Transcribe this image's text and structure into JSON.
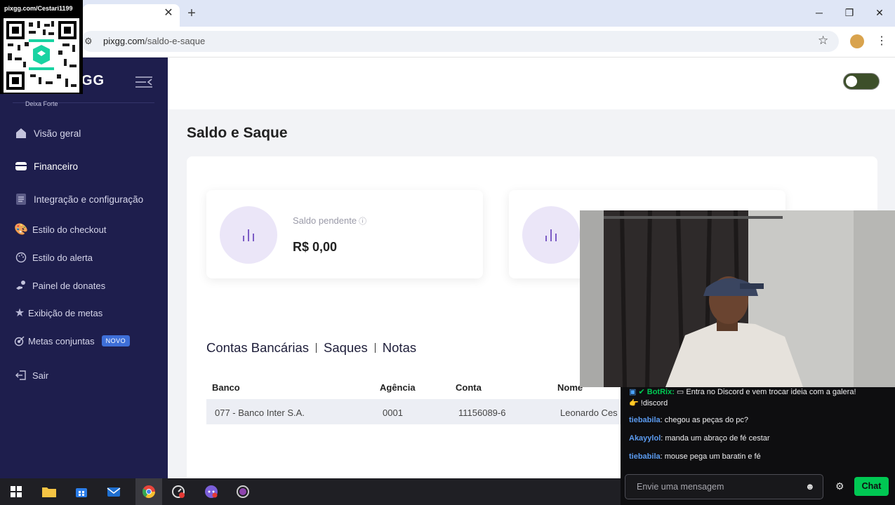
{
  "browser": {
    "url_domain": "pixgg.com",
    "url_path": "/saldo-e-saque",
    "tab_close": "✕",
    "new_tab": "+",
    "minimize": "─",
    "restore": "❐",
    "close": "✕"
  },
  "overlay": {
    "qr_label": "pixgg.com/Cestari1199"
  },
  "sidebar": {
    "logo": "GG",
    "brand": "Deixa Forte",
    "items": [
      {
        "label": "Visão geral",
        "icon": "home-icon"
      },
      {
        "label": "Financeiro",
        "icon": "wallet-icon"
      },
      {
        "label": "Integração e configuração",
        "icon": "document-icon"
      },
      {
        "label": "Estilo do checkout",
        "icon": "palette-icon"
      },
      {
        "label": "Estilo do alerta",
        "icon": "palette-icon"
      },
      {
        "label": "Painel de donates",
        "icon": "hand-coin-icon"
      },
      {
        "label": "Exibição de metas",
        "icon": "star-icon"
      },
      {
        "label": "Metas conjuntas",
        "icon": "target-icon",
        "badge": "NOVO"
      },
      {
        "label": "Sair",
        "icon": "logout-icon"
      }
    ],
    "active_item": "Financeiro"
  },
  "main": {
    "title": "Saldo e Saque",
    "cards": [
      {
        "label": "Saldo pendente",
        "value": "R$ 0,00"
      },
      {
        "label": "",
        "value": ""
      }
    ],
    "tabs": [
      "Contas Bancárias",
      "Saques",
      "Notas"
    ],
    "table": {
      "headers": [
        "Banco",
        "Agência",
        "Conta",
        "Nome"
      ],
      "rows": [
        [
          "077 - Banco Inter S.A.",
          "0001",
          "11156089-6",
          "Leonardo Ces"
        ]
      ]
    }
  },
  "chat": {
    "messages": [
      {
        "user": "BotRix:",
        "text": "Entra no Discord e vem trocar ideia com a galera!",
        "text2": "!discord",
        "color": "#00c853"
      },
      {
        "user": "tiebabila",
        "text": ": chegou as peças do pc?",
        "color": "#5b9bf0"
      },
      {
        "user": "Akayylol",
        "text": ": manda um abraço de fé cestar",
        "color": "#5b9bf0"
      },
      {
        "user": "tiebabila",
        "text": ": mouse pega um baratin e fé",
        "color": "#5b9bf0"
      }
    ],
    "input_placeholder": "Envie uma mensagem",
    "send_label": "Chat"
  }
}
